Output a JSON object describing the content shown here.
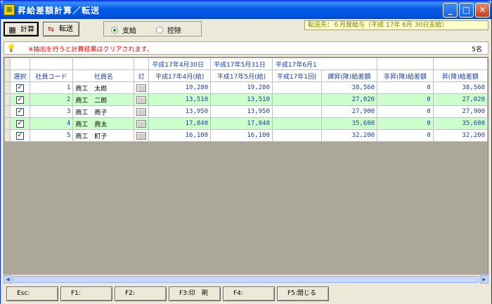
{
  "window": {
    "title": "昇給差額計算／転送",
    "app_icon": "spreadsheet-app-icon",
    "controls": [
      "minimize-icon",
      "maximize-icon",
      "close-icon"
    ]
  },
  "toolbar": {
    "calc_label": "計算",
    "transfer_label": "転送",
    "radio_pay": "支給",
    "radio_deduct": "控除",
    "radio_selected": "支給",
    "destination": "転送先：６月度給与（平成 17年 6月 30日支給）"
  },
  "notice": {
    "message": "※抽出を行うと計算結果はクリアされます。",
    "count": "5名"
  },
  "grid": {
    "group_headers": {
      "g1": "平成17年4月30日",
      "g2": "平成17年5月31日",
      "g3": "平成17年6月1"
    },
    "headers": {
      "select": "選択",
      "code": "社員コード",
      "name": "社員名",
      "fix": "訂",
      "apr": "平成17年4月(給)",
      "may": "平成17年5月(給)",
      "jun": "平成17年1回(",
      "taxable": "課昇(降)給差額",
      "nontax": "非昇(降)給差額",
      "total": "昇(降)給差額"
    },
    "rows": [
      {
        "code": "1",
        "name": "商工　太郎",
        "apr": "19,280",
        "may": "19,280",
        "jun": "",
        "taxable": "38,560",
        "nontax": "0",
        "total": "38,560"
      },
      {
        "code": "2",
        "name": "商工　二郎",
        "apr": "13,510",
        "may": "13,510",
        "jun": "",
        "taxable": "27,020",
        "nontax": "0",
        "total": "27,020"
      },
      {
        "code": "3",
        "name": "商工　商子",
        "apr": "13,950",
        "may": "13,950",
        "jun": "",
        "taxable": "27,900",
        "nontax": "0",
        "total": "27,900"
      },
      {
        "code": "4",
        "name": "商工　商太",
        "apr": "17,840",
        "may": "17,840",
        "jun": "",
        "taxable": "35,680",
        "nontax": "0",
        "total": "35,680"
      },
      {
        "code": "5",
        "name": "商工　町子",
        "apr": "16,100",
        "may": "16,100",
        "jun": "",
        "taxable": "32,200",
        "nontax": "0",
        "total": "32,200"
      }
    ]
  },
  "fkeys": [
    "Esc:",
    "F1:",
    "F2:",
    "F3:印　刷",
    "F4:",
    "F5:閉じる"
  ]
}
